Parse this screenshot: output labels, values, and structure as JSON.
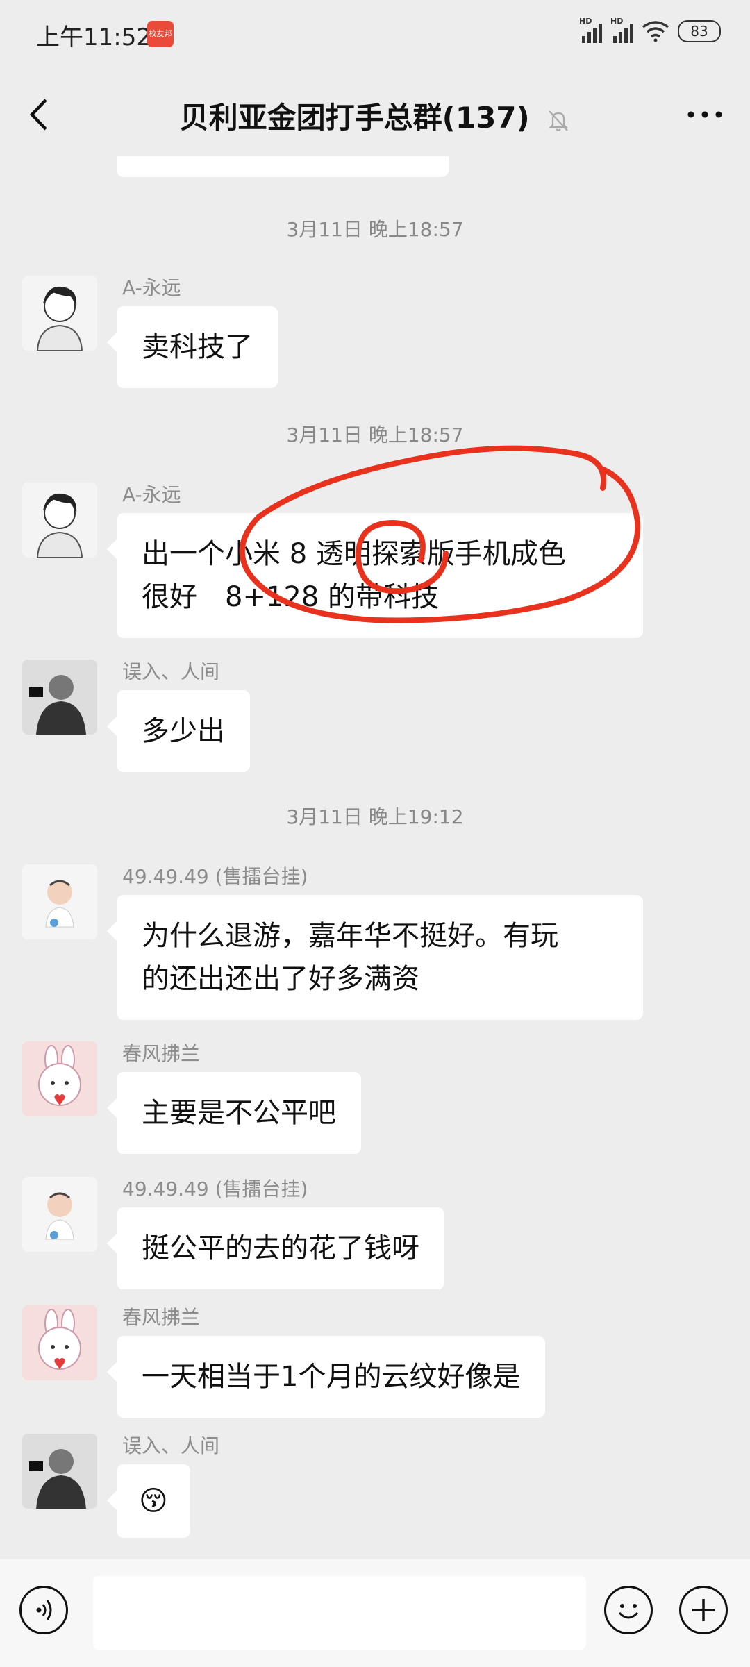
{
  "status_bar": {
    "time": "上午11:52",
    "app_badge": "校友邦",
    "hd1": "HD",
    "hd2": "HD",
    "battery": "83"
  },
  "header": {
    "title": "贝利亚金团打手总群(137)"
  },
  "messages": [
    {
      "timestamp": "3月11日 晚上18:57",
      "sender": "A-永远",
      "text": "卖科技了"
    },
    {
      "timestamp": "3月11日 晚上18:57",
      "sender": "A-永远",
      "line1": "出一个小米 8 透明探索版手机成色",
      "line2": "很好　8+128 的带科技"
    },
    {
      "sender": "误入、人间",
      "text": "多少出"
    },
    {
      "timestamp": "3月11日 晚上19:12",
      "sender": "49.49.49 (售擂台挂)",
      "line1": "为什么退游，嘉年华不挺好。有玩",
      "line2": "的还出还出了好多满资"
    },
    {
      "sender": "春风拂兰",
      "text": "主要是不公平吧"
    },
    {
      "sender": "49.49.49 (售擂台挂)",
      "text": "挺公平的去的花了钱呀"
    },
    {
      "sender": "春风拂兰",
      "text": "一天相当于1个月的云纹好像是"
    },
    {
      "sender": "误入、人间",
      "emoji": "😚"
    }
  ],
  "colors": {
    "background": "#ededed",
    "bubble": "#ffffff",
    "annotation": "#e8321e"
  }
}
